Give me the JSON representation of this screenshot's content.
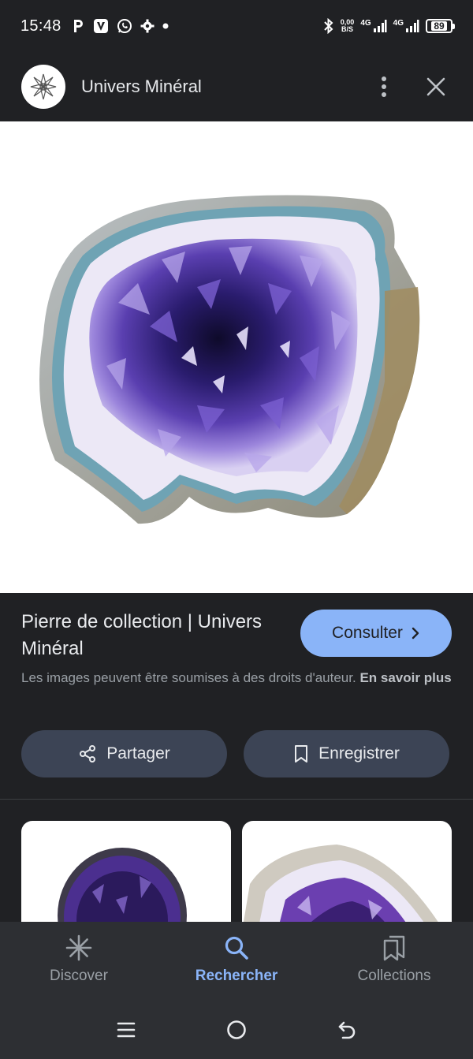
{
  "status_bar": {
    "time": "15:48",
    "net_speed_value": "0,00",
    "net_speed_unit": "B/S",
    "signal_1": "4G",
    "signal_2": "4G",
    "battery": "89"
  },
  "header": {
    "title": "Univers Minéral",
    "icons": [
      "more-vert-icon",
      "close-icon"
    ]
  },
  "result": {
    "title": "Pierre de collection | Univers Minéral",
    "visit_label": "Consulter",
    "copyright_text": "Les images peuvent être soumises à des droits d'auteur.",
    "learn_more": "En savoir plus",
    "share_label": "Partager",
    "save_label": "Enregistrer"
  },
  "bottom_nav": {
    "items": [
      {
        "label": "Discover",
        "icon": "discover-asterisk-icon",
        "active": false
      },
      {
        "label": "Rechercher",
        "icon": "search-icon",
        "active": true
      },
      {
        "label": "Collections",
        "icon": "collections-icon",
        "active": false
      }
    ]
  },
  "colors": {
    "background": "#202124",
    "accent": "#8ab4f8",
    "button_bg": "#3c4455",
    "nav_bg": "#2d2f33"
  }
}
